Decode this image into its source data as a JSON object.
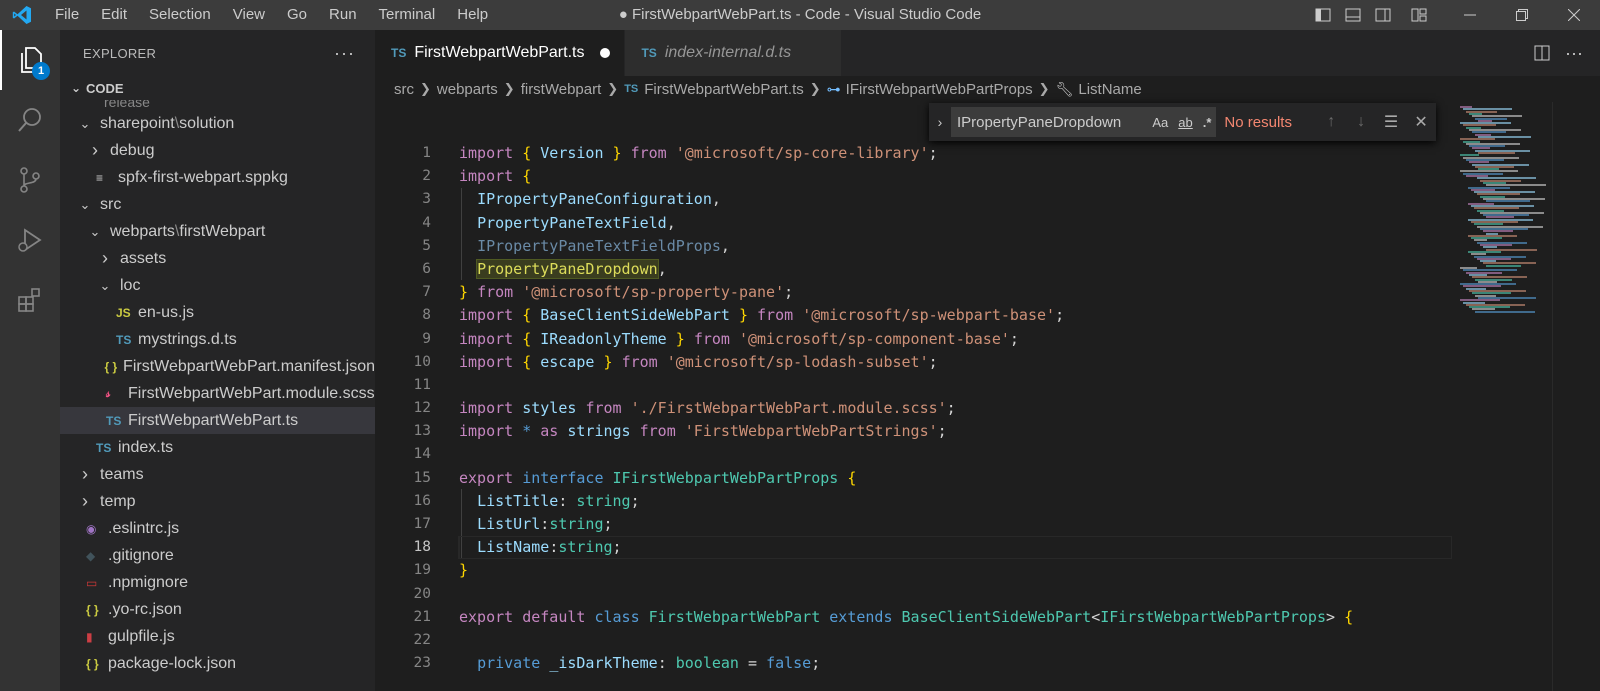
{
  "titlebar": {
    "menu": [
      "File",
      "Edit",
      "Selection",
      "View",
      "Go",
      "Run",
      "Terminal",
      "Help"
    ],
    "title": "● FirstWebpartWebPart.ts - Code - Visual Studio Code"
  },
  "activity": {
    "badge": "1"
  },
  "sidebar": {
    "header": "EXPLORER",
    "more": "···",
    "section": "CODE",
    "partial": "release",
    "rows": [
      {
        "kind": "folder-open",
        "indent": 0,
        "name_a": "sharepoint",
        "sep": "\\",
        "name_b": "solution"
      },
      {
        "kind": "folder",
        "indent": 1,
        "name_a": "debug"
      },
      {
        "kind": "file",
        "indent": 1,
        "icon": "≡",
        "icon_color": "#cccccc",
        "name_a": "spfx-first-webpart.sppkg"
      },
      {
        "kind": "folder-open",
        "indent": 0,
        "name_a": "src"
      },
      {
        "kind": "folder-open",
        "indent": 1,
        "name_a": "webparts",
        "sep": "\\",
        "name_b": "firstWebpart"
      },
      {
        "kind": "folder",
        "indent": 2,
        "name_a": "assets"
      },
      {
        "kind": "folder-open",
        "indent": 2,
        "name_a": "loc"
      },
      {
        "kind": "file",
        "indent": 3,
        "icon": "JS",
        "icon_color": "#cbcb41",
        "name_a": "en-us.js"
      },
      {
        "kind": "file",
        "indent": 3,
        "icon": "TS",
        "icon_color": "#519aba",
        "name_a": "mystrings.d.ts"
      },
      {
        "kind": "file",
        "indent": 2,
        "icon": "{ }",
        "icon_color": "#cbcb41",
        "name_a": "FirstWebpartWebPart.manifest.json"
      },
      {
        "kind": "file",
        "indent": 2,
        "icon": "𝓈",
        "icon_color": "#f55385",
        "name_a": "FirstWebpartWebPart.module.scss"
      },
      {
        "kind": "file",
        "indent": 2,
        "icon": "TS",
        "icon_color": "#519aba",
        "name_a": "FirstWebpartWebPart.ts",
        "selected": true
      },
      {
        "kind": "file",
        "indent": 1,
        "icon": "TS",
        "icon_color": "#519aba",
        "name_a": "index.ts"
      },
      {
        "kind": "folder",
        "indent": 0,
        "name_a": "teams"
      },
      {
        "kind": "folder",
        "indent": 0,
        "name_a": "temp"
      },
      {
        "kind": "file",
        "indent": 0,
        "icon": "◉",
        "icon_color": "#a074c4",
        "name_a": ".eslintrc.js"
      },
      {
        "kind": "file",
        "indent": 0,
        "icon": "◆",
        "icon_color": "#41535b",
        "name_a": ".gitignore"
      },
      {
        "kind": "file",
        "indent": 0,
        "icon": "▭",
        "icon_color": "#cb3837",
        "name_a": ".npmignore"
      },
      {
        "kind": "file",
        "indent": 0,
        "icon": "{ }",
        "icon_color": "#cbcb41",
        "name_a": ".yo-rc.json"
      },
      {
        "kind": "file",
        "indent": 0,
        "icon": "▮",
        "icon_color": "#cc3e44",
        "name_a": "gulpfile.js"
      },
      {
        "kind": "file",
        "indent": 0,
        "icon": "{ }",
        "icon_color": "#cbcb41",
        "name_a": "package-lock.json"
      }
    ]
  },
  "tabs": [
    {
      "icon": "TS",
      "label": "FirstWebpartWebPart.ts",
      "active": true,
      "dirty": true
    },
    {
      "icon": "TS",
      "label": "index-internal.d.ts",
      "active": false,
      "italic": true
    }
  ],
  "breadcrumb": {
    "items": [
      "src",
      "webparts",
      "firstWebpart"
    ],
    "file": "FirstWebpartWebPart.ts",
    "interface": "IFirstWebpartWebPartProps",
    "member": "ListName"
  },
  "find": {
    "query": "IPropertyPaneDropdown",
    "opt_case": "Aa",
    "opt_word": "ab",
    "opt_regex": ".*",
    "result": "No results"
  },
  "editor": {
    "current_line": 18,
    "lines": [
      [
        [
          "kw",
          "import"
        ],
        [
          "p",
          " "
        ],
        [
          "br",
          "{"
        ],
        [
          "p",
          " "
        ],
        [
          "var",
          "Version"
        ],
        [
          "p",
          " "
        ],
        [
          "br",
          "}"
        ],
        [
          "p",
          " "
        ],
        [
          "kw",
          "from"
        ],
        [
          "p",
          " "
        ],
        [
          "str",
          "'@microsoft/sp-core-library'"
        ],
        [
          "p",
          ";"
        ]
      ],
      [
        [
          "kw",
          "import"
        ],
        [
          "p",
          " "
        ],
        [
          "br",
          "{"
        ]
      ],
      [
        [
          "p",
          "  "
        ],
        [
          "var",
          "IPropertyPaneConfiguration"
        ],
        [
          "p",
          ","
        ]
      ],
      [
        [
          "p",
          "  "
        ],
        [
          "var",
          "PropertyPaneTextField"
        ],
        [
          "p",
          ","
        ]
      ],
      [
        [
          "p",
          "  "
        ],
        [
          "dim",
          "IPropertyPaneTextFieldProps"
        ],
        [
          "p",
          ","
        ]
      ],
      [
        [
          "p",
          "  "
        ],
        [
          "hl",
          "PropertyPaneDropdown"
        ],
        [
          "p",
          ","
        ]
      ],
      [
        [
          "br",
          "}"
        ],
        [
          "p",
          " "
        ],
        [
          "kw",
          "from"
        ],
        [
          "p",
          " "
        ],
        [
          "str",
          "'@microsoft/sp-property-pane'"
        ],
        [
          "p",
          ";"
        ]
      ],
      [
        [
          "kw",
          "import"
        ],
        [
          "p",
          " "
        ],
        [
          "br",
          "{"
        ],
        [
          "p",
          " "
        ],
        [
          "var",
          "BaseClientSideWebPart"
        ],
        [
          "p",
          " "
        ],
        [
          "br",
          "}"
        ],
        [
          "p",
          " "
        ],
        [
          "kw",
          "from"
        ],
        [
          "p",
          " "
        ],
        [
          "str",
          "'@microsoft/sp-webpart-base'"
        ],
        [
          "p",
          ";"
        ]
      ],
      [
        [
          "kw",
          "import"
        ],
        [
          "p",
          " "
        ],
        [
          "br",
          "{"
        ],
        [
          "p",
          " "
        ],
        [
          "var",
          "IReadonlyTheme"
        ],
        [
          "p",
          " "
        ],
        [
          "br",
          "}"
        ],
        [
          "p",
          " "
        ],
        [
          "kw",
          "from"
        ],
        [
          "p",
          " "
        ],
        [
          "str",
          "'@microsoft/sp-component-base'"
        ],
        [
          "p",
          ";"
        ]
      ],
      [
        [
          "kw",
          "import"
        ],
        [
          "p",
          " "
        ],
        [
          "br",
          "{"
        ],
        [
          "p",
          " "
        ],
        [
          "var",
          "escape"
        ],
        [
          "p",
          " "
        ],
        [
          "br",
          "}"
        ],
        [
          "p",
          " "
        ],
        [
          "kw",
          "from"
        ],
        [
          "p",
          " "
        ],
        [
          "str",
          "'@microsoft/sp-lodash-subset'"
        ],
        [
          "p",
          ";"
        ]
      ],
      [],
      [
        [
          "kw",
          "import"
        ],
        [
          "p",
          " "
        ],
        [
          "var",
          "styles"
        ],
        [
          "p",
          " "
        ],
        [
          "kw",
          "from"
        ],
        [
          "p",
          " "
        ],
        [
          "str",
          "'./FirstWebpartWebPart.module.scss'"
        ],
        [
          "p",
          ";"
        ]
      ],
      [
        [
          "kw",
          "import"
        ],
        [
          "p",
          " "
        ],
        [
          "kwb",
          "*"
        ],
        [
          "p",
          " "
        ],
        [
          "kw",
          "as"
        ],
        [
          "p",
          " "
        ],
        [
          "var",
          "strings"
        ],
        [
          "p",
          " "
        ],
        [
          "kw",
          "from"
        ],
        [
          "p",
          " "
        ],
        [
          "str",
          "'FirstWebpartWebPartStrings'"
        ],
        [
          "p",
          ";"
        ]
      ],
      [],
      [
        [
          "kw",
          "export"
        ],
        [
          "p",
          " "
        ],
        [
          "kwb",
          "interface"
        ],
        [
          "p",
          " "
        ],
        [
          "ifc",
          "IFirstWebpartWebPartProps"
        ],
        [
          "p",
          " "
        ],
        [
          "br",
          "{"
        ]
      ],
      [
        [
          "p",
          "  "
        ],
        [
          "var",
          "ListTitle"
        ],
        [
          "p",
          ": "
        ],
        [
          "typ",
          "string"
        ],
        [
          "p",
          ";"
        ]
      ],
      [
        [
          "p",
          "  "
        ],
        [
          "var",
          "ListUrl"
        ],
        [
          "p",
          ":"
        ],
        [
          "typ",
          "string"
        ],
        [
          "p",
          ";"
        ]
      ],
      [
        [
          "p",
          "  "
        ],
        [
          "var",
          "ListName"
        ],
        [
          "p",
          ":"
        ],
        [
          "typ",
          "string"
        ],
        [
          "p",
          ";"
        ]
      ],
      [
        [
          "br",
          "}"
        ]
      ],
      [],
      [
        [
          "kw",
          "export"
        ],
        [
          "p",
          " "
        ],
        [
          "kw",
          "default"
        ],
        [
          "p",
          " "
        ],
        [
          "kwb",
          "class"
        ],
        [
          "p",
          " "
        ],
        [
          "cls",
          "FirstWebpartWebPart"
        ],
        [
          "p",
          " "
        ],
        [
          "kwb",
          "extends"
        ],
        [
          "p",
          " "
        ],
        [
          "cls",
          "BaseClientSideWebPart"
        ],
        [
          "p",
          "<"
        ],
        [
          "cls",
          "IFirstWebpartWebPartProps"
        ],
        [
          "p",
          "> "
        ],
        [
          "br",
          "{"
        ]
      ],
      [],
      [
        [
          "p",
          "  "
        ],
        [
          "kwb",
          "private"
        ],
        [
          "p",
          " "
        ],
        [
          "var",
          "_isDarkTheme"
        ],
        [
          "p",
          ": "
        ],
        [
          "typ",
          "boolean"
        ],
        [
          "p",
          " = "
        ],
        [
          "kwb",
          "false"
        ],
        [
          "p",
          ";"
        ]
      ]
    ]
  }
}
